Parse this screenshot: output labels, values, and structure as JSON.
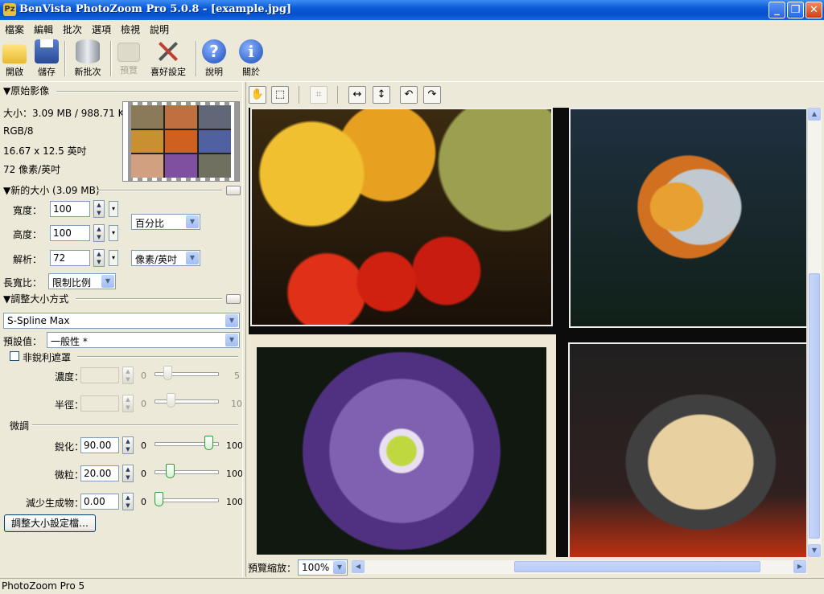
{
  "window": {
    "title": "BenVista PhotoZoom Pro 5.0.8 - [example.jpg]",
    "minimize": "_",
    "maximize": "❐",
    "close": "✕"
  },
  "menu": [
    "檔案",
    "編輯",
    "批次",
    "選項",
    "檢視",
    "說明"
  ],
  "toolbar": {
    "open": "開啟",
    "save": "儲存",
    "new_batch": "新批次",
    "preview": "預覽",
    "preferences": "喜好設定",
    "help": "說明",
    "about": "關於"
  },
  "original": {
    "header": "▼原始影像",
    "size": "大小：3.09 MB / 988.71 KB",
    "mode": "RGB/8",
    "dimensions": "16.67 x 12.5 英吋",
    "resolution": "72 像素/英吋"
  },
  "new_size": {
    "header": "▼新的大小 (3.09 MB)",
    "width_label": "寬度：",
    "width_value": "100",
    "height_label": "高度：",
    "height_value": "100",
    "res_label": "解析：",
    "res_value": "72",
    "unit": "百分比",
    "res_unit": "像素/英吋",
    "aspect_label": "長寬比：",
    "aspect_value": "限制比例"
  },
  "resize": {
    "header": "▼調整大小方式",
    "method": "S-Spline Max",
    "preset_label": "預設值：",
    "preset_value": "一般性 *",
    "unsharp_label": "非銳利遮罩",
    "amount_label": "濃度：",
    "amount_min": "0",
    "amount_max": "5",
    "radius_label": "半徑：",
    "radius_min": "0",
    "radius_max": "10",
    "fine_label": "微調",
    "sharpen_label": "銳化：",
    "sharpen_value": "90.00",
    "sharpen_min": "0",
    "sharpen_max": "100",
    "sharpen_level": 0.9,
    "grain_label": "微粒：",
    "grain_value": "20.00",
    "grain_min": "0",
    "grain_max": "100",
    "grain_level": 0.2,
    "artifact_label": "減少生成物：",
    "artifact_value": "0.00",
    "artifact_min": "0",
    "artifact_max": "100",
    "artifact_level": 0.0,
    "profiles_button": "調整大小設定檔…"
  },
  "preview_area": {
    "zoom_label": "預覽縮放：",
    "zoom_value": "100%"
  },
  "status": "PhotoZoom Pro 5"
}
